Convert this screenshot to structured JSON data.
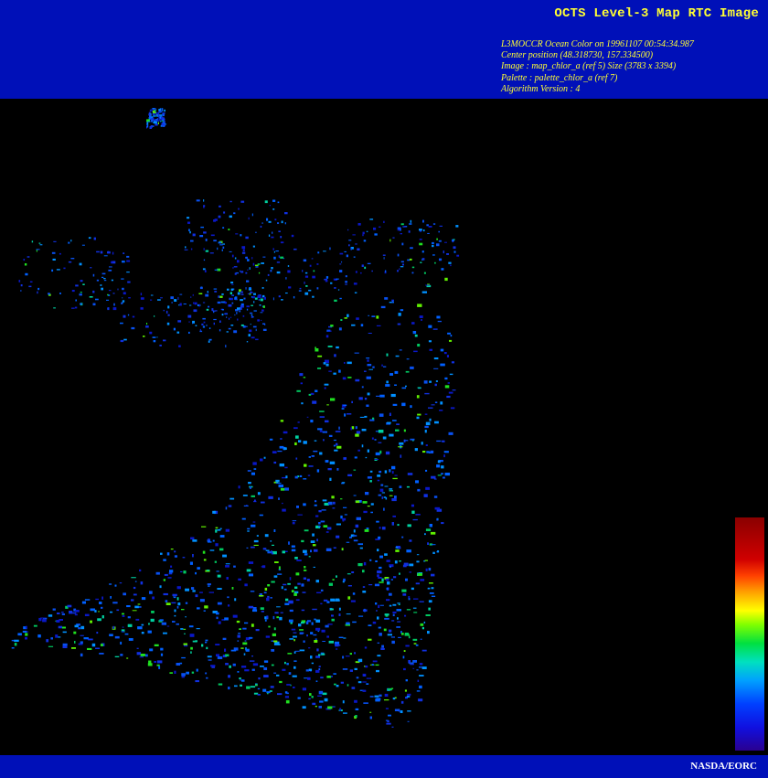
{
  "header": {
    "title": "OCTS Level-3 Map RTC Image",
    "meta_lines": [
      "L3MOCCR Ocean Color on 19961107 00:54:34.987",
      "Center position (48.318730, 157.334500)",
      "Image : map_chlor_a (ref 5) Size (3783 x 3394)",
      "Palette : palette_chlor_a (ref 7)",
      "Algorithm Version : 4"
    ]
  },
  "colors": {
    "header_bg": "#0010B8",
    "title_text": "#FFFF33",
    "map_bg": "#000000",
    "credit_text": "#FFFFFF"
  },
  "palette": [
    "#2A0090",
    "#1010E0",
    "#0040FF",
    "#00A0FF",
    "#00E0C0",
    "#00E040",
    "#80FF00",
    "#FFFF00",
    "#FFA000",
    "#FF4000",
    "#D00000",
    "#8A0000"
  ],
  "footer": {
    "credit": "NASDA/EORC"
  }
}
